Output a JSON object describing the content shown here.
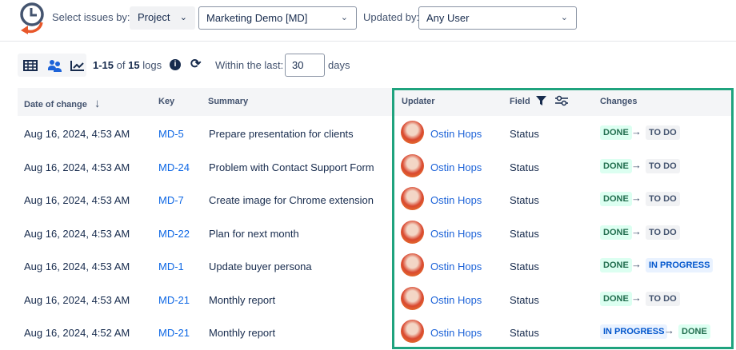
{
  "header": {
    "select_label": "Select issues by:",
    "select_by": "Project",
    "project": "Marketing Demo [MD]",
    "updated_by_label": "Updated by:",
    "updated_by": "Any User"
  },
  "toolbar": {
    "range": "1-15",
    "of": "of",
    "total": "15",
    "logs": "logs",
    "within_label": "Within the last:",
    "days_value": "30",
    "days_label": "days"
  },
  "columns": {
    "date": "Date of change",
    "key": "Key",
    "summary": "Summary",
    "updater": "Updater",
    "field": "Field",
    "changes": "Changes"
  },
  "rows": [
    {
      "date": "Aug 16, 2024, 4:53 AM",
      "key": "MD-5",
      "summary": "Prepare presentation for clients",
      "updater": "Ostin Hops",
      "field": "Status",
      "from": "DONE",
      "to": "TO DO"
    },
    {
      "date": "Aug 16, 2024, 4:53 AM",
      "key": "MD-24",
      "summary": "Problem with Contact Support Form",
      "updater": "Ostin Hops",
      "field": "Status",
      "from": "DONE",
      "to": "TO DO"
    },
    {
      "date": "Aug 16, 2024, 4:53 AM",
      "key": "MD-7",
      "summary": "Create image for Chrome extension",
      "updater": "Ostin Hops",
      "field": "Status",
      "from": "DONE",
      "to": "TO DO"
    },
    {
      "date": "Aug 16, 2024, 4:53 AM",
      "key": "MD-22",
      "summary": "Plan for next month",
      "updater": "Ostin Hops",
      "field": "Status",
      "from": "DONE",
      "to": "TO DO"
    },
    {
      "date": "Aug 16, 2024, 4:53 AM",
      "key": "MD-1",
      "summary": "Update buyer persona",
      "updater": "Ostin Hops",
      "field": "Status",
      "from": "DONE",
      "to": "IN PROGRESS"
    },
    {
      "date": "Aug 16, 2024, 4:53 AM",
      "key": "MD-21",
      "summary": "Monthly report",
      "updater": "Ostin Hops",
      "field": "Status",
      "from": "DONE",
      "to": "TO DO"
    },
    {
      "date": "Aug 16, 2024, 4:52 AM",
      "key": "MD-21",
      "summary": "Monthly report",
      "updater": "Ostin Hops",
      "field": "Status",
      "from": "IN PROGRESS",
      "to": "DONE"
    }
  ]
}
